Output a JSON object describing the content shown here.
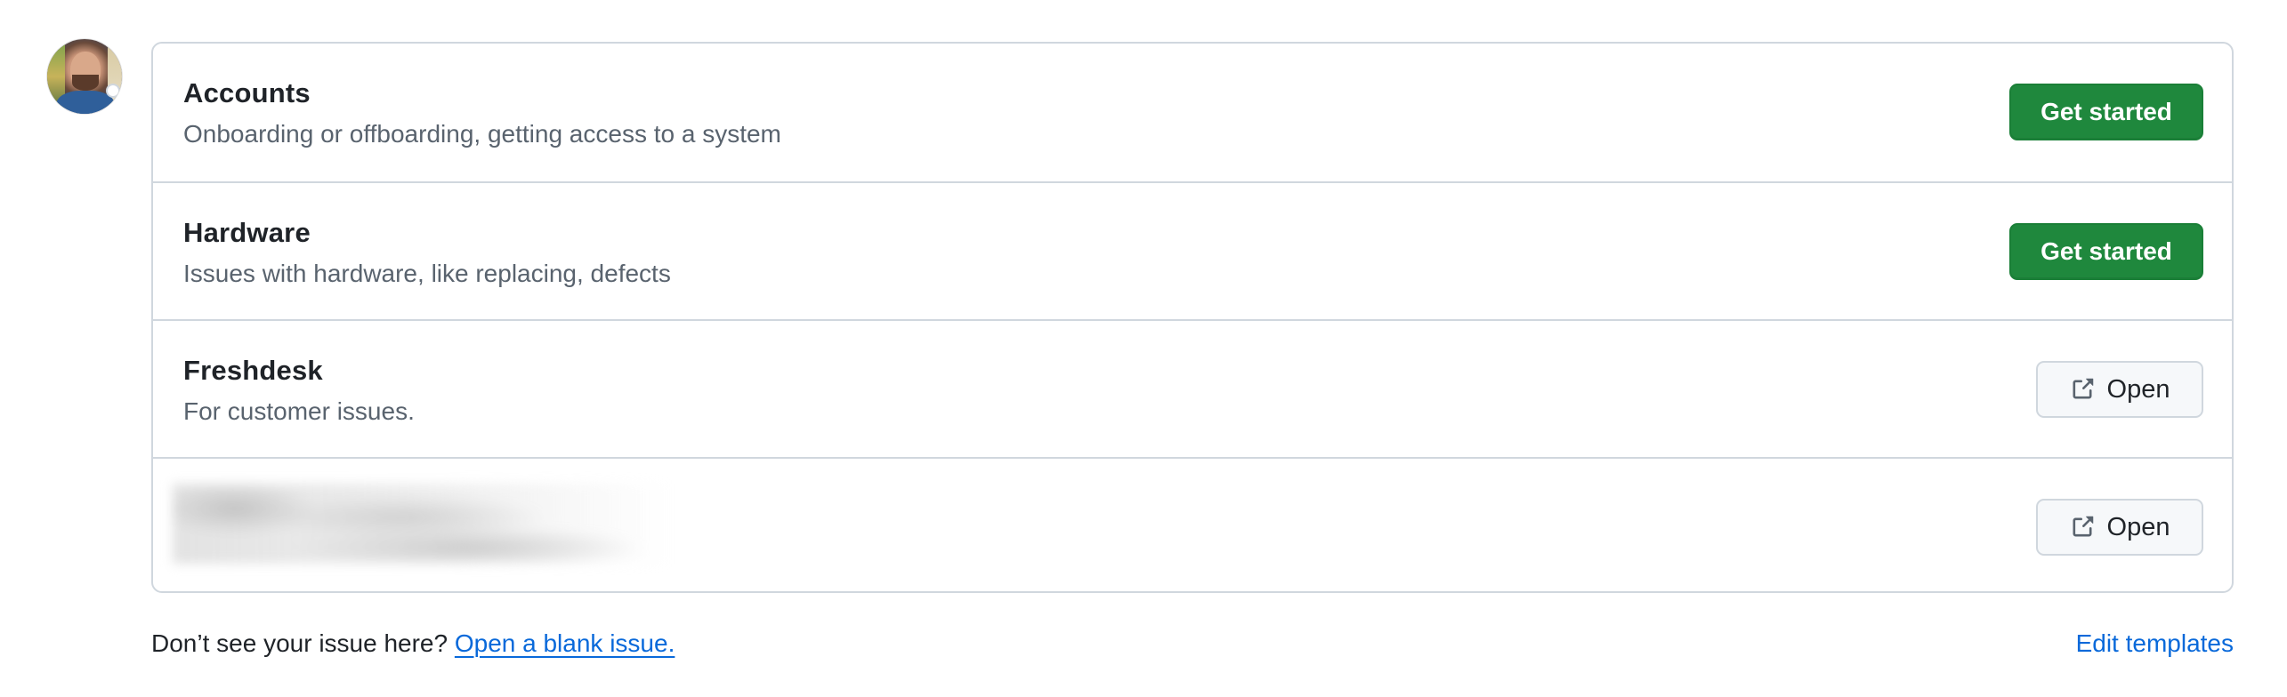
{
  "templates": [
    {
      "title": "Accounts",
      "description": "Onboarding or offboarding, getting access to a system",
      "action_label": "Get started",
      "action_type": "primary"
    },
    {
      "title": "Hardware",
      "description": "Issues with hardware, like replacing, defects",
      "action_label": "Get started",
      "action_type": "primary"
    },
    {
      "title": "Freshdesk",
      "description": "For customer issues.",
      "action_label": "Open",
      "action_type": "external",
      "icon": "link-external-icon"
    },
    {
      "title": "",
      "description": "",
      "action_label": "Open",
      "action_type": "external",
      "icon": "link-external-icon",
      "redacted": true
    }
  ],
  "footer": {
    "prompt": "Don’t see your issue here? ",
    "blank_issue_link": "Open a blank issue.",
    "edit_templates_link": "Edit templates"
  },
  "colors": {
    "primary_button": "#1f883d",
    "link": "#0969da",
    "border": "#d0d7de",
    "muted_text": "#59636e"
  }
}
